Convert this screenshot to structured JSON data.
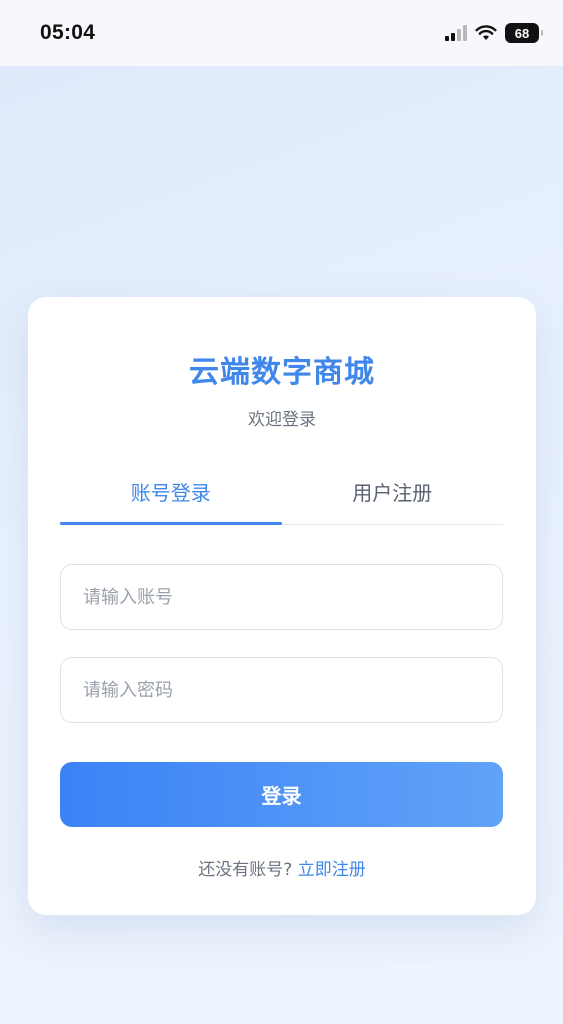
{
  "status_bar": {
    "time": "05:04",
    "battery": "68",
    "icons": [
      "cellular-signal-icon",
      "wifi-icon",
      "battery-icon"
    ]
  },
  "app": {
    "title": "云端数字商城",
    "subtitle": "欢迎登录"
  },
  "tabs": [
    {
      "label": "账号登录",
      "active": true
    },
    {
      "label": "用户注册",
      "active": false
    }
  ],
  "form": {
    "account_placeholder": "请输入账号",
    "account_value": "",
    "password_placeholder": "请输入密码",
    "password_value": "",
    "submit_label": "登录"
  },
  "footer": {
    "prompt": "还没有账号?",
    "register_link": "立即注册"
  },
  "colors": {
    "accent": "#3f87ea",
    "button_start": "#3b82f6",
    "button_end": "#61a3f8",
    "background": "#e9f1fd",
    "muted_text": "#6b7480"
  }
}
